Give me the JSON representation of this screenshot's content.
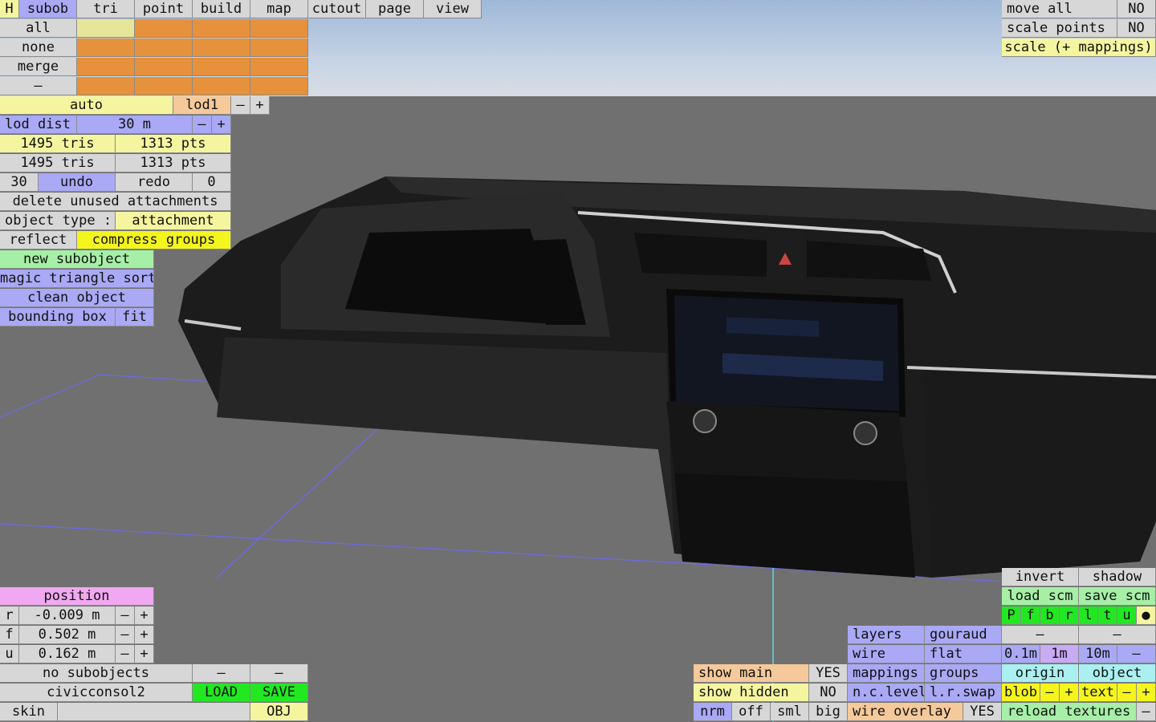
{
  "top_tabs": [
    "H",
    "subob",
    "tri",
    "point",
    "build",
    "map",
    "cutout",
    "page",
    "view"
  ],
  "select": {
    "all": "all",
    "none": "none",
    "merge": "merge",
    "dash": "–"
  },
  "lod": {
    "auto": "auto",
    "lod1": "lod1",
    "minus": "–",
    "plus": "+",
    "dist_label": "lod dist",
    "dist_value": "30 m"
  },
  "stats": {
    "tris_a": "1495 tris",
    "pts_a": "1313 pts",
    "tris_b": "1495 tris",
    "pts_b": "1313 pts"
  },
  "undo_row": {
    "count": "30",
    "undo": "undo",
    "redo": "redo",
    "redo_count": "0"
  },
  "actions": {
    "delete_unused": "delete unused attachments",
    "object_type_label": "object type :",
    "object_type_value": "attachment",
    "reflect": "reflect",
    "compress": "compress groups",
    "new_subobject": "new subobject",
    "magic_sort": "magic triangle sort",
    "clean_object": "clean object",
    "bounding_box": "bounding box",
    "fit": "fit"
  },
  "top_right": {
    "move_all": "move all",
    "move_all_val": "NO",
    "scale_points": "scale points",
    "scale_points_val": "NO",
    "scale_mappings": "scale (+ mappings)"
  },
  "position": {
    "title": "position",
    "rows": [
      {
        "axis": "r",
        "value": "-0.009 m"
      },
      {
        "axis": "f",
        "value": "0.502 m"
      },
      {
        "axis": "u",
        "value": "0.162 m"
      }
    ],
    "minus": "–",
    "plus": "+"
  },
  "file": {
    "no_subobjects": "no subobjects",
    "dash": "–",
    "name": "civicconsol2",
    "load": "LOAD",
    "save": "SAVE",
    "skin": "skin",
    "obj": "OBJ"
  },
  "display": {
    "show_main": "show main",
    "show_main_val": "YES",
    "show_hidden": "show hidden",
    "show_hidden_val": "NO",
    "nrm": "nrm",
    "off": "off",
    "sml": "sml",
    "big": "big",
    "layers": "layers",
    "gouraud": "gouraud",
    "wire": "wire",
    "flat": "flat",
    "mappings": "mappings",
    "groups": "groups",
    "nc_level": "n.c.level",
    "lr_swap": "l.r.swap",
    "wire_overlay": "wire overlay",
    "wire_overlay_val": "YES"
  },
  "right_panel": {
    "invert": "invert",
    "shadow": "shadow",
    "load_scm": "load scm",
    "save_scm": "save scm",
    "letters": [
      "P",
      "f",
      "b",
      "r",
      "l",
      "t",
      "u"
    ],
    "dot": "●",
    "dash": "–",
    "step1": "0.1m",
    "step2": "1m",
    "step3": "10m",
    "origin": "origin",
    "object": "object",
    "blob": "blob",
    "text": "text",
    "minus": "–",
    "plus": "+",
    "reload_textures": "reload textures"
  },
  "colors": {
    "gray": "#d7d7d7",
    "blue": "#a9a9f5",
    "yellow": "#f5f5a0",
    "orange": "#e6913c",
    "green": "#a6efa6",
    "bright_green": "#22e822"
  }
}
